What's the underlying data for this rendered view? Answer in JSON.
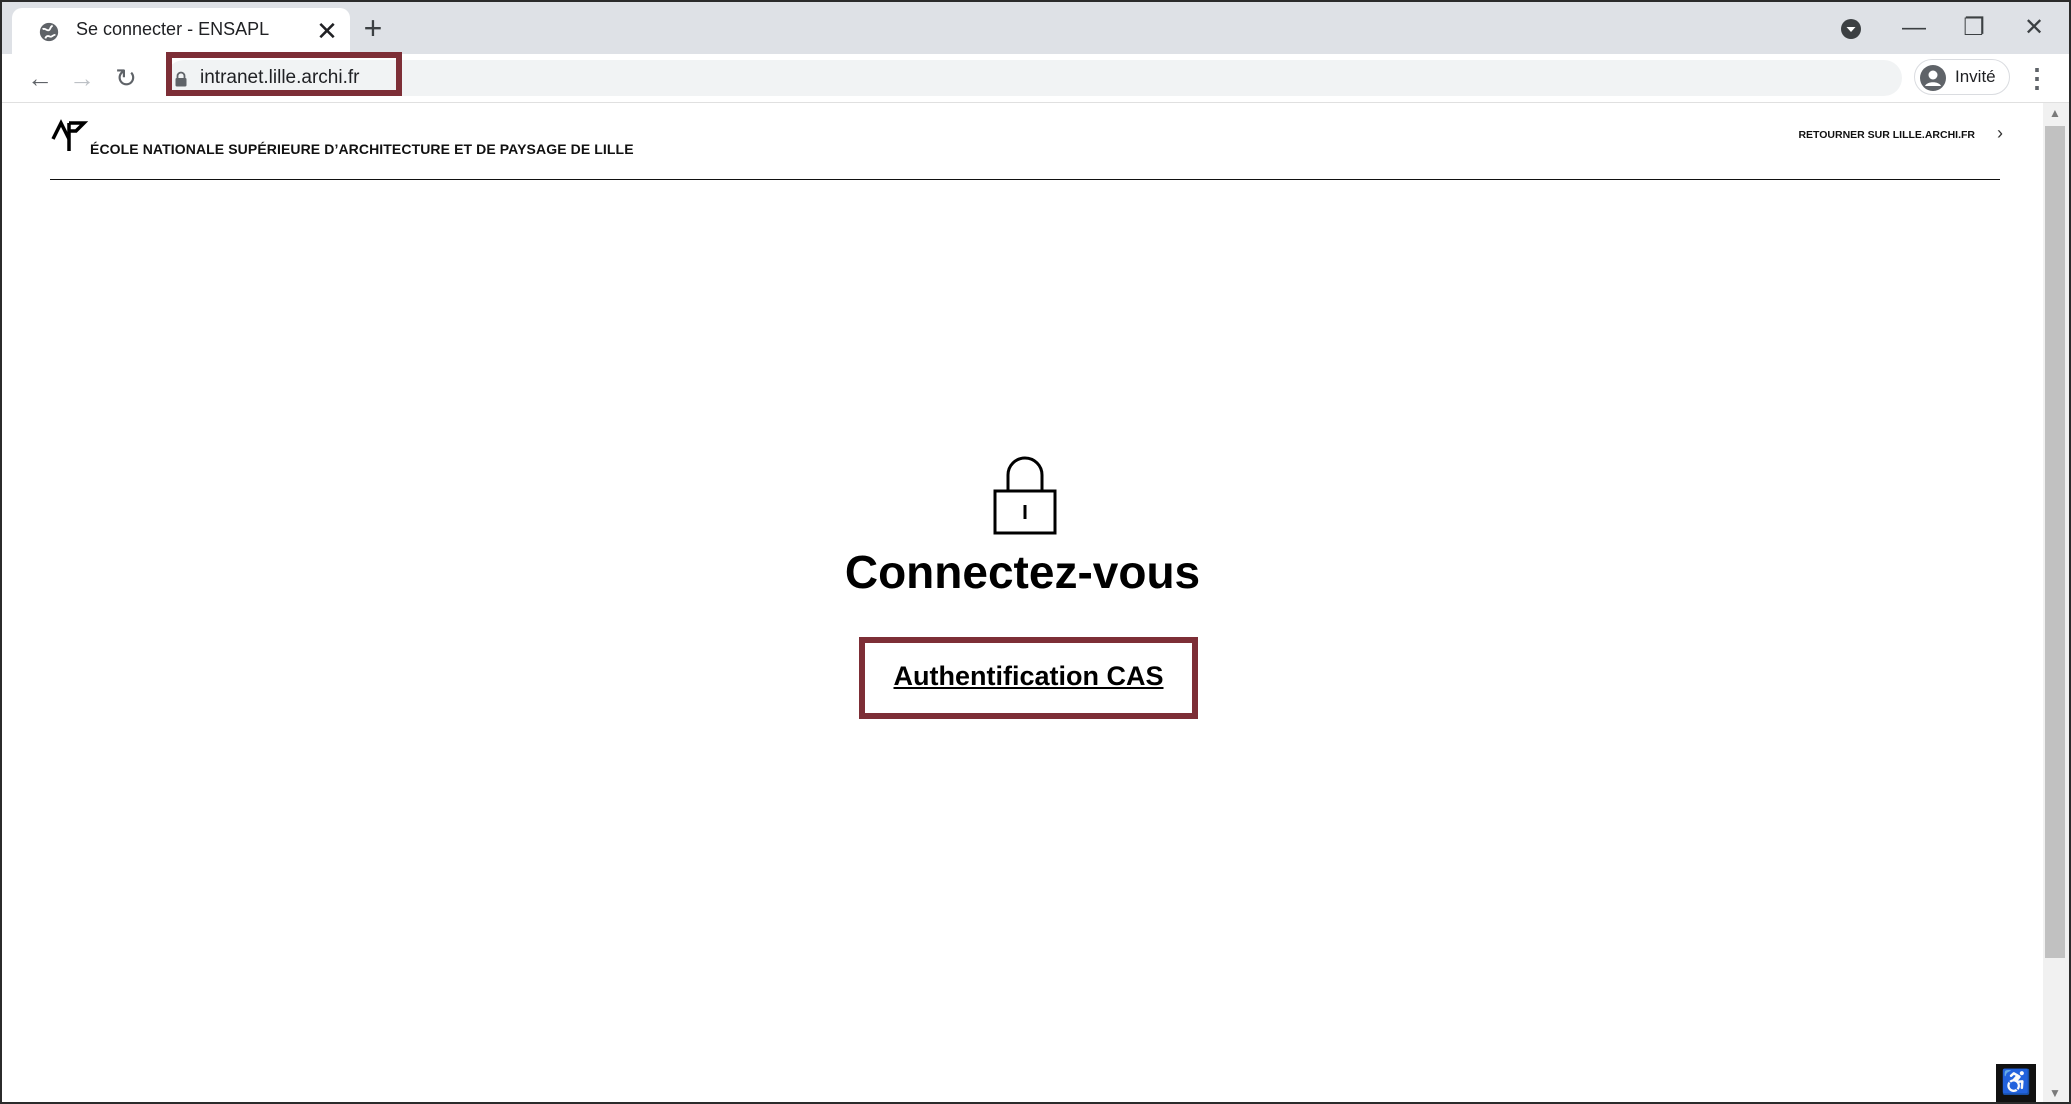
{
  "browser": {
    "tab_title": "Se connecter - ENSAPL",
    "tab_close": "✕",
    "new_tab": "+",
    "url": "intranet.lille.archi.fr",
    "profile_name": "Invité",
    "minimize": "—",
    "restore": "❐",
    "close": "✕",
    "back": "←",
    "forward": "→",
    "reload": "↻",
    "menu": "⋮",
    "highlight_color": "#7d2e36"
  },
  "header": {
    "school_name": "ÉCOLE NATIONALE SUPÉRIEURE D’ARCHITECTURE ET DE PAYSAGE DE LILLE",
    "return_link": "RETOURNER SUR LILLE.ARCHI.FR",
    "return_arrow": "›"
  },
  "main": {
    "heading": "Connectez-vous",
    "cas_link": "Authentification CAS"
  },
  "accessibility_button": "♿",
  "scrollbar": {
    "up": "▲",
    "down": "▼"
  },
  "icons": {
    "favicon": "globe-icon",
    "lock": "lock-icon",
    "avatar": "user-avatar-icon",
    "logo": "ap-logo",
    "accessibility": "accessibility-icon"
  }
}
